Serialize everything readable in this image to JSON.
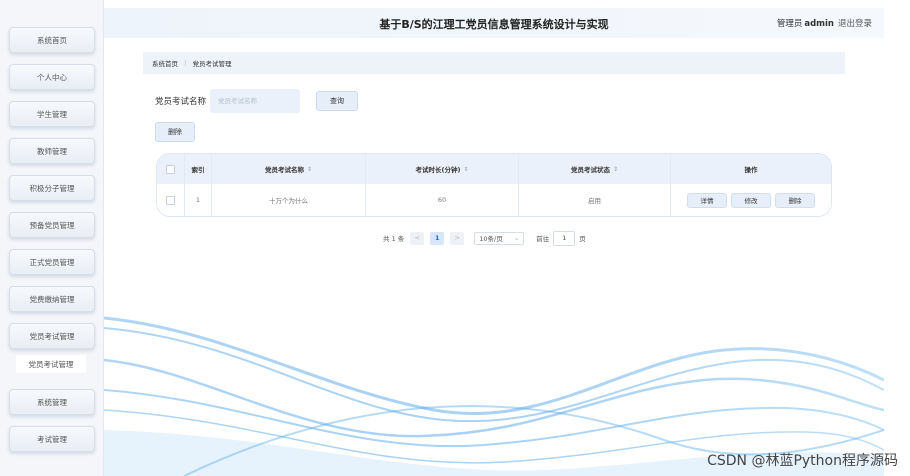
{
  "header": {
    "title": "基于B/S的江理工党员信息管理系统设计与实现",
    "user_role": "管理员",
    "user_name": "admin",
    "logout_label": "退出登录"
  },
  "sidebar": {
    "items": [
      {
        "label": "系统首页"
      },
      {
        "label": "个人中心"
      },
      {
        "label": "学生管理"
      },
      {
        "label": "教师管理"
      },
      {
        "label": "积极分子管理"
      },
      {
        "label": "预备党员管理"
      },
      {
        "label": "正式党员管理"
      },
      {
        "label": "党费缴纳管理"
      },
      {
        "label": "党员考试管理"
      },
      {
        "label": "系统管理"
      },
      {
        "label": "考试管理"
      }
    ],
    "expanded_sub_item": "党员考试管理"
  },
  "breadcrumb": {
    "home": "系统首页",
    "separator": "⋮",
    "current": "党员考试管理"
  },
  "search": {
    "label": "党员考试名称",
    "placeholder": "党员考试名称",
    "query_label": "查询"
  },
  "toolbar": {
    "delete_label": "删除"
  },
  "table": {
    "columns": [
      "索引",
      "党员考试名称",
      "考试时长(分钟)",
      "党员考试状态",
      "操作"
    ],
    "sort_icon": "⇕",
    "rows": [
      {
        "index": "1",
        "name": "十万个为什么",
        "duration": "60",
        "status": "启用"
      }
    ],
    "actions": [
      "详情",
      "修改",
      "删除"
    ]
  },
  "pagination": {
    "total_text": "共 1 条",
    "prev": "<",
    "current_page": "1",
    "next": ">",
    "page_size": "10条/页",
    "goto_prefix": "前往",
    "goto_value": "1",
    "goto_suffix": "页"
  },
  "watermark": "CSDN @林蓝Python程序源码",
  "colors": {
    "accent": "#1b6fd6",
    "header_bg": "#eaf1fa",
    "wave": "#4aa3e8"
  }
}
